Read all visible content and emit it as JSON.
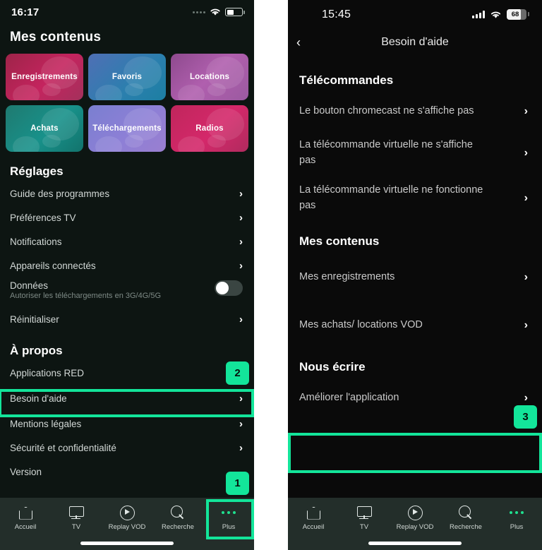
{
  "left_phone": {
    "status": {
      "time": "16:17",
      "signal_icon": "dots-signal-icon",
      "wifi_icon": "wifi-icon",
      "battery_icon": "battery-icon"
    },
    "page_title": "Mes contenus",
    "tiles": [
      {
        "label": "Enregistrements",
        "color": "#c4245e"
      },
      {
        "label": "Favoris",
        "color": "#2b7fae"
      },
      {
        "label": "Locations",
        "color": "#b05fae"
      },
      {
        "label": "Achats",
        "color": "#18918a"
      },
      {
        "label": "Téléchargements",
        "color": "#8d7fd6"
      },
      {
        "label": "Radios",
        "color": "#d4286a"
      }
    ],
    "settings_header": "Réglages",
    "settings_rows": [
      {
        "label": "Guide des programmes",
        "type": "chevron"
      },
      {
        "label": "Préférences TV",
        "type": "chevron"
      },
      {
        "label": "Notifications",
        "type": "chevron"
      },
      {
        "label": "Appareils connectés",
        "type": "chevron"
      },
      {
        "label": "Données",
        "sub": "Autoriser les téléchargements en 3G/4G/5G",
        "type": "toggle",
        "toggle_on": false
      },
      {
        "label": "Réinitialiser",
        "type": "chevron"
      }
    ],
    "about_header": "À propos",
    "about_rows": [
      {
        "label": "Applications RED",
        "type": "plain"
      },
      {
        "label": "Besoin d'aide",
        "type": "chevron"
      },
      {
        "label": "Mentions légales",
        "type": "chevron"
      },
      {
        "label": "Sécurité et confidentialité",
        "type": "chevron"
      },
      {
        "label": "Version",
        "type": "plain"
      }
    ],
    "tabbar": [
      {
        "label": "Accueil",
        "icon": "home-icon"
      },
      {
        "label": "TV",
        "icon": "tv-icon"
      },
      {
        "label": "Replay VOD",
        "icon": "play-circle-icon"
      },
      {
        "label": "Recherche",
        "icon": "search-icon"
      },
      {
        "label": "Plus",
        "icon": "more-dots-icon"
      }
    ]
  },
  "right_phone": {
    "status": {
      "time": "15:45",
      "signal_icon": "bars-signal-icon",
      "wifi_icon": "wifi-icon",
      "battery_level": "68"
    },
    "nav": {
      "back_icon": "chevron-left-icon",
      "title": "Besoin d'aide"
    },
    "sections": [
      {
        "header": "Télécommandes",
        "rows": [
          {
            "label": "Le bouton chromecast ne s'affiche pas"
          },
          {
            "label": "La télécommande virtuelle ne s'affiche pas"
          },
          {
            "label": "La télécommande virtuelle ne fonctionne pas"
          }
        ]
      },
      {
        "header": "Mes contenus",
        "rows": [
          {
            "label": "Mes enregistrements"
          },
          {
            "label": "Mes achats/ locations VOD"
          }
        ]
      },
      {
        "header": "Nous écrire",
        "rows": [
          {
            "label": "Améliorer l'application"
          }
        ]
      }
    ],
    "tabbar": [
      {
        "label": "Accueil",
        "icon": "home-icon"
      },
      {
        "label": "TV",
        "icon": "tv-icon"
      },
      {
        "label": "Replay VOD",
        "icon": "play-circle-icon"
      },
      {
        "label": "Recherche",
        "icon": "search-icon"
      },
      {
        "label": "Plus",
        "icon": "more-dots-icon"
      }
    ]
  },
  "annotations": {
    "accent_color": "#13e59a",
    "badges": [
      {
        "number": "1",
        "target": "plus-tab-left"
      },
      {
        "number": "2",
        "target": "besoin-daide-row"
      },
      {
        "number": "3",
        "target": "ameliorer-lapplication-row"
      }
    ]
  }
}
